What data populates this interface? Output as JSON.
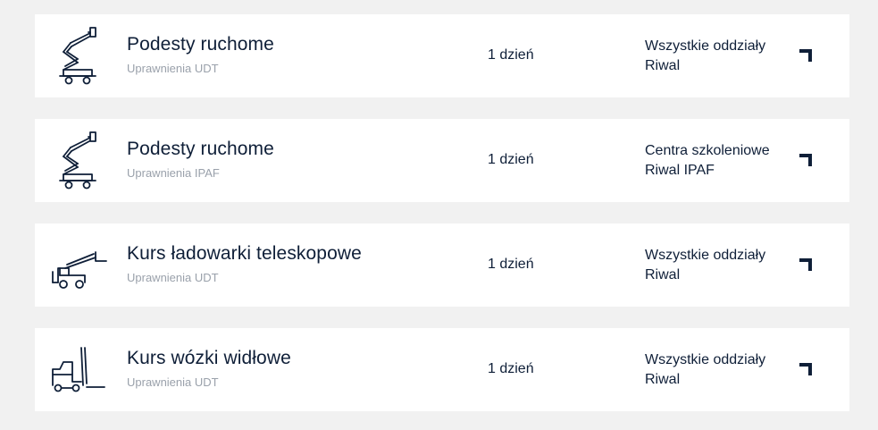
{
  "courses": [
    {
      "title": "Podesty ruchome",
      "subtitle": "Uprawnienia UDT",
      "duration": "1 dzień",
      "location_line1": "Wszystkie oddziały",
      "location_line2": "Riwal",
      "icon": "aerial-platform-icon"
    },
    {
      "title": "Podesty ruchome",
      "subtitle": "Uprawnienia IPAF",
      "duration": "1 dzień",
      "location_line1": "Centra szkoleniowe",
      "location_line2": "Riwal IPAF",
      "icon": "aerial-platform-icon"
    },
    {
      "title": "Kurs ładowarki teleskopowe",
      "subtitle": "Uprawnienia UDT",
      "duration": "1 dzień",
      "location_line1": "Wszystkie oddziały",
      "location_line2": "Riwal",
      "icon": "telehandler-icon"
    },
    {
      "title": "Kurs wózki widłowe",
      "subtitle": "Uprawnienia UDT",
      "duration": "1 dzień",
      "location_line1": "Wszystkie oddziały",
      "location_line2": "Riwal",
      "icon": "forklift-icon"
    }
  ],
  "colors": {
    "background": "#f1f1f1",
    "card": "#ffffff",
    "text": "#0f1f38",
    "muted": "#9aa1ab"
  }
}
